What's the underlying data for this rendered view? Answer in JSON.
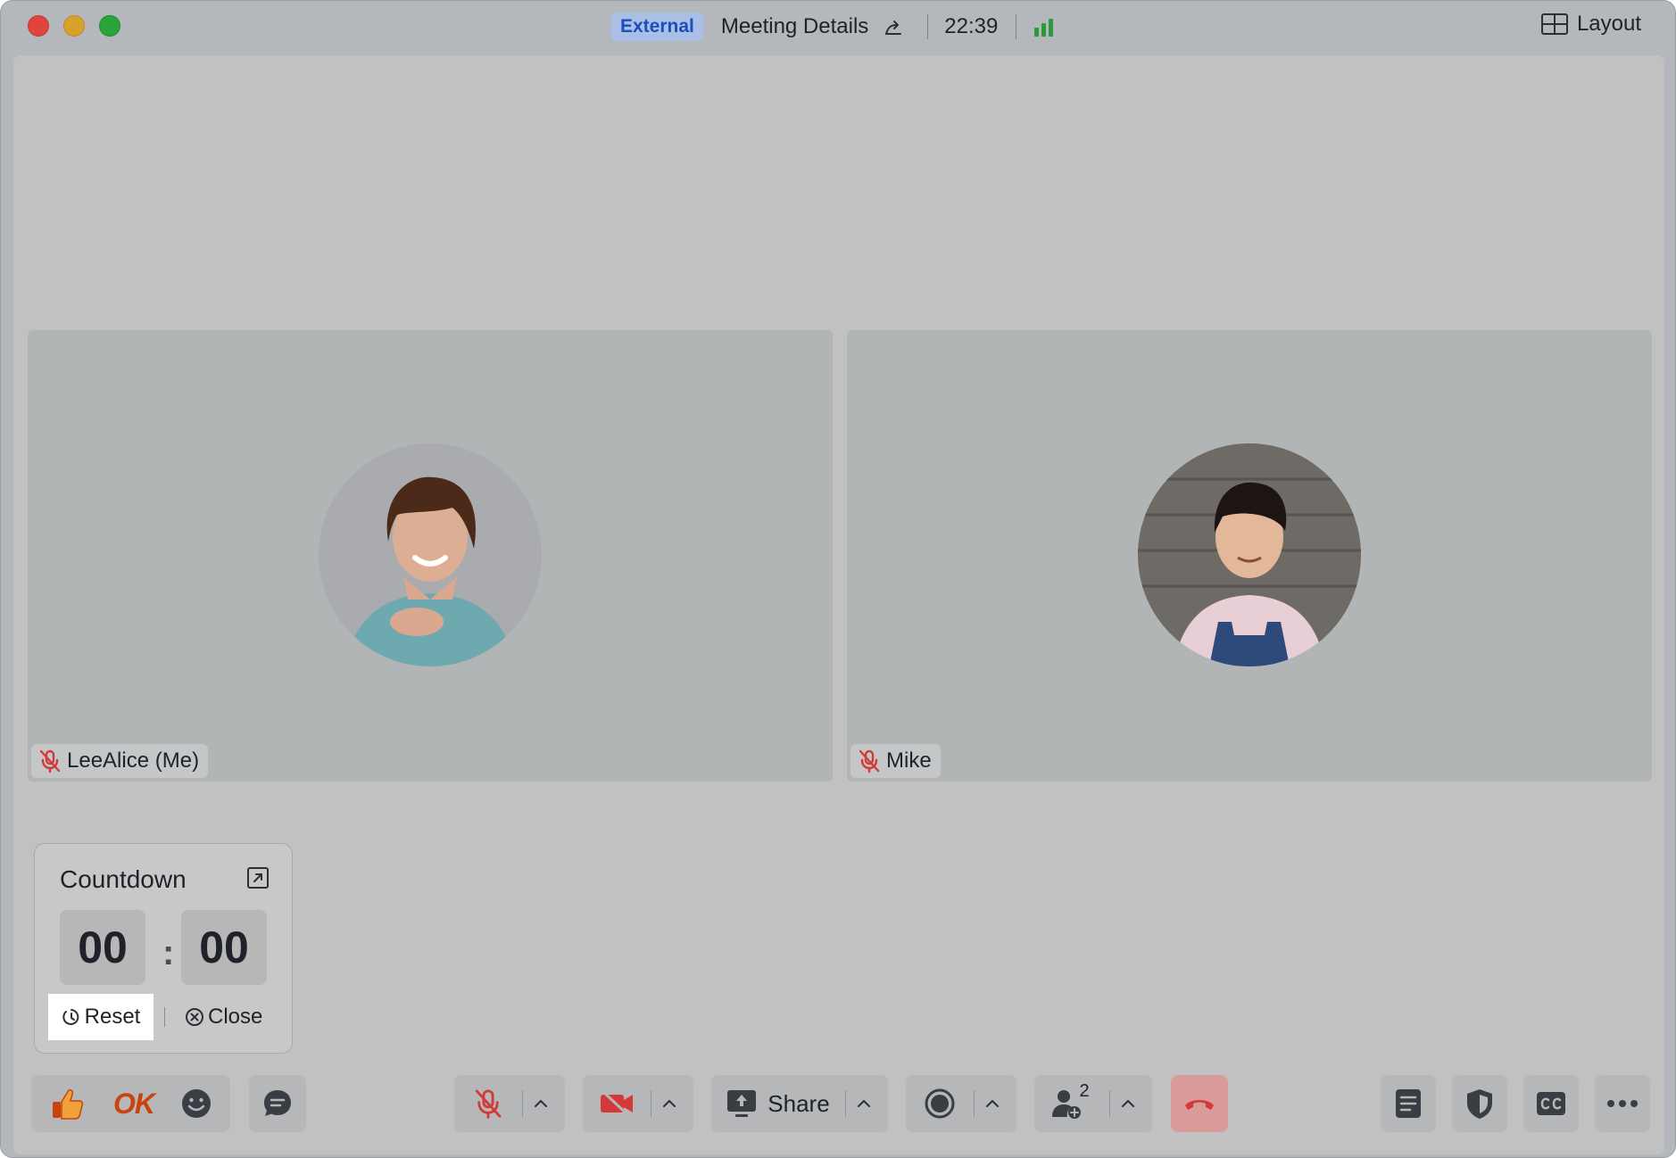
{
  "titlebar": {
    "badge": "External",
    "meeting_details": "Meeting Details",
    "clock": "22:39",
    "layout_label": "Layout"
  },
  "participants": [
    {
      "name": "LeeAlice (Me)",
      "muted": true
    },
    {
      "name": "Mike",
      "muted": true
    }
  ],
  "countdown": {
    "title": "Countdown",
    "minutes": "00",
    "seconds": "00",
    "separator": ":",
    "reset_label": "Reset",
    "close_label": "Close"
  },
  "toolbar": {
    "reaction_ok": "OK",
    "share_label": "Share",
    "participants_count": "2"
  },
  "colors": {
    "accent_blue": "#1a4fbf",
    "signal_green": "#2a9a3a",
    "muted_red": "#d4393a",
    "end_call_red": "#d99a9a"
  }
}
